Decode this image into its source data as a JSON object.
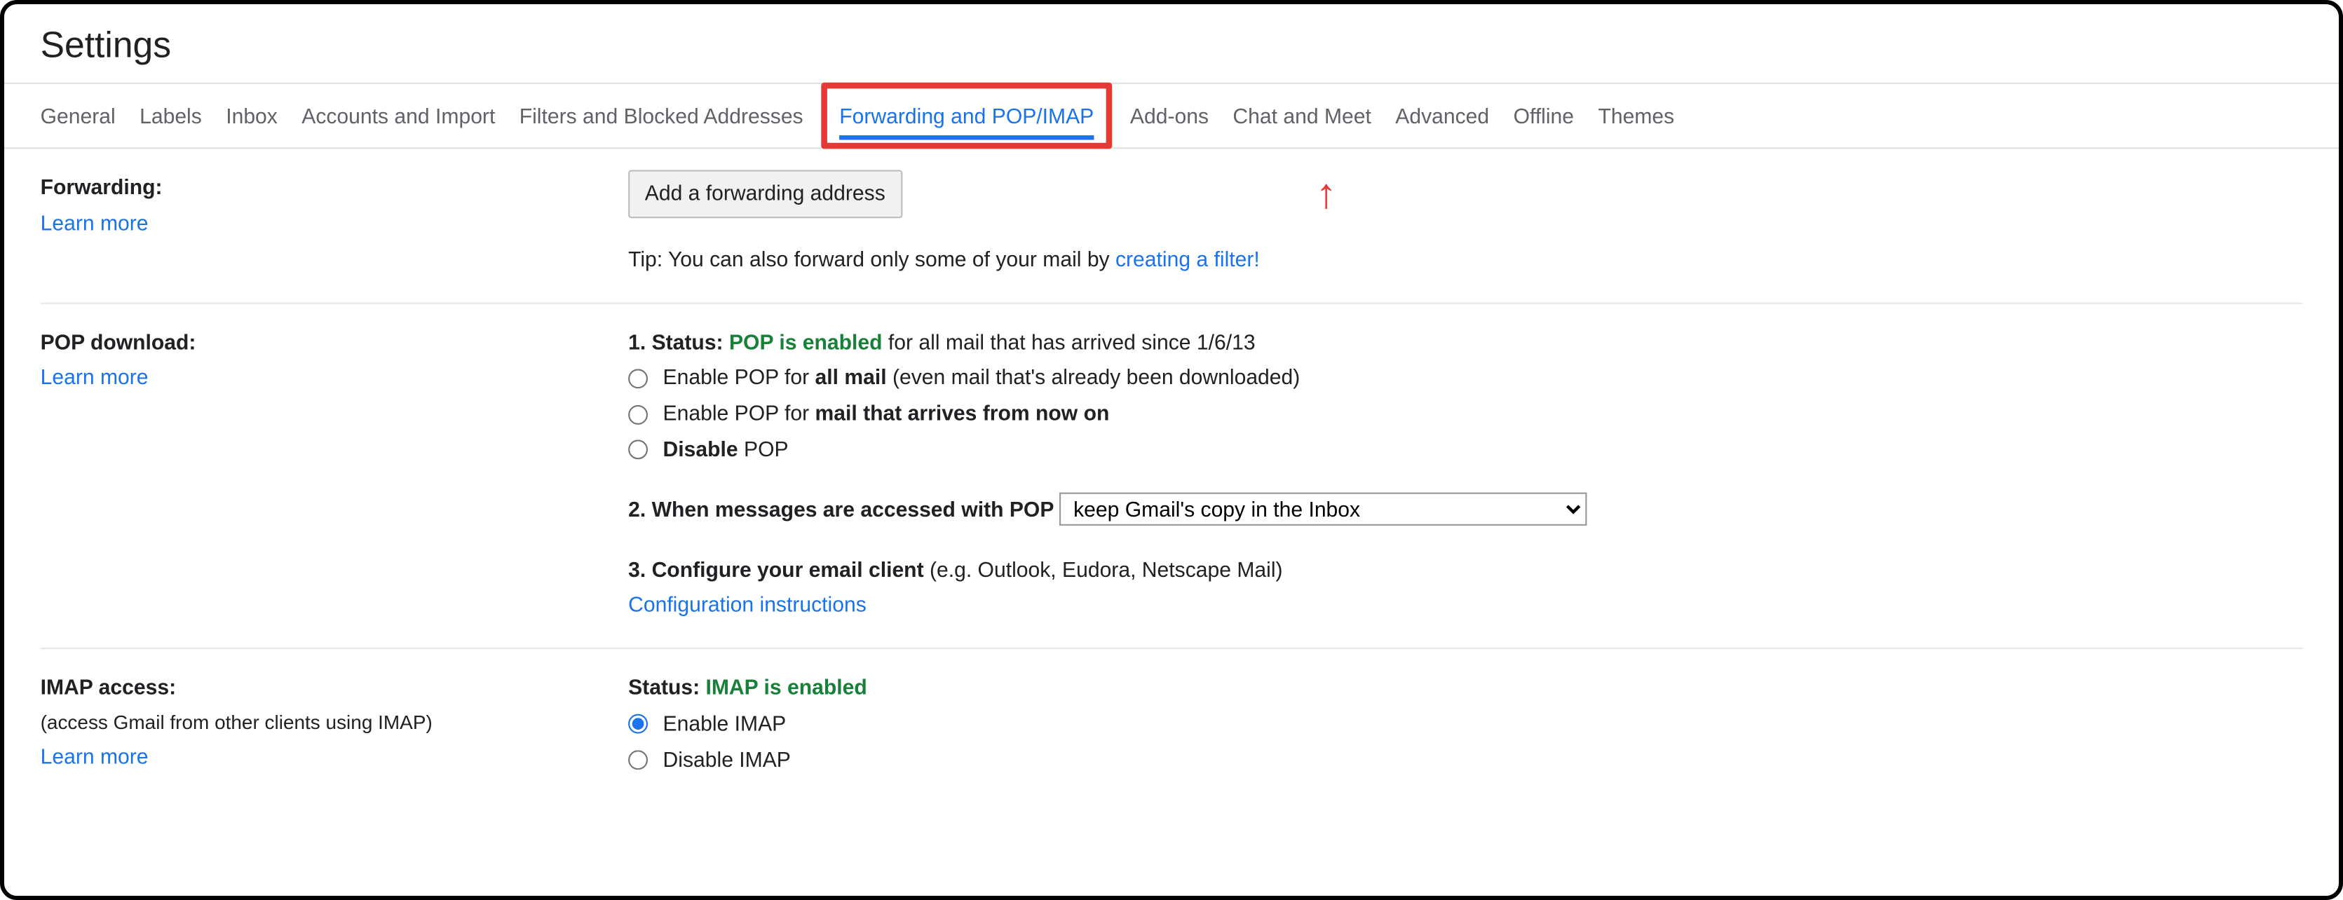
{
  "page_title": "Settings",
  "tabs": {
    "general": "General",
    "labels": "Labels",
    "inbox": "Inbox",
    "accounts": "Accounts and Import",
    "filters": "Filters and Blocked Addresses",
    "forwarding": "Forwarding and POP/IMAP",
    "addons": "Add-ons",
    "chat": "Chat and Meet",
    "advanced": "Advanced",
    "offline": "Offline",
    "themes": "Themes"
  },
  "forwarding": {
    "heading": "Forwarding:",
    "learn_more": "Learn more",
    "add_button": "Add a forwarding address",
    "tip_prefix": "Tip: You can also forward only some of your mail by ",
    "tip_link": "creating a filter!"
  },
  "pop": {
    "heading": "POP download:",
    "learn_more": "Learn more",
    "status_prefix": "1. Status: ",
    "status_value": "POP is enabled",
    "status_suffix": " for all mail that has arrived since 1/6/13",
    "opt1_prefix": "Enable POP for ",
    "opt1_bold": "all mail",
    "opt1_suffix": " (even mail that's already been downloaded)",
    "opt2_prefix": "Enable POP for ",
    "opt2_bold": "mail that arrives from now on",
    "opt3_bold": "Disable",
    "opt3_suffix": " POP",
    "q2": "2. When messages are accessed with POP",
    "q2_selected": "keep Gmail's copy in the Inbox",
    "q3_bold": "3. Configure your email client",
    "q3_suffix": " (e.g. Outlook, Eudora, Netscape Mail)",
    "config_link": "Configuration instructions"
  },
  "imap": {
    "heading": "IMAP access:",
    "sub": "(access Gmail from other clients using IMAP)",
    "learn_more": "Learn more",
    "status_prefix": "Status: ",
    "status_value": "IMAP is enabled",
    "opt_enable": "Enable IMAP",
    "opt_disable": "Disable IMAP"
  }
}
